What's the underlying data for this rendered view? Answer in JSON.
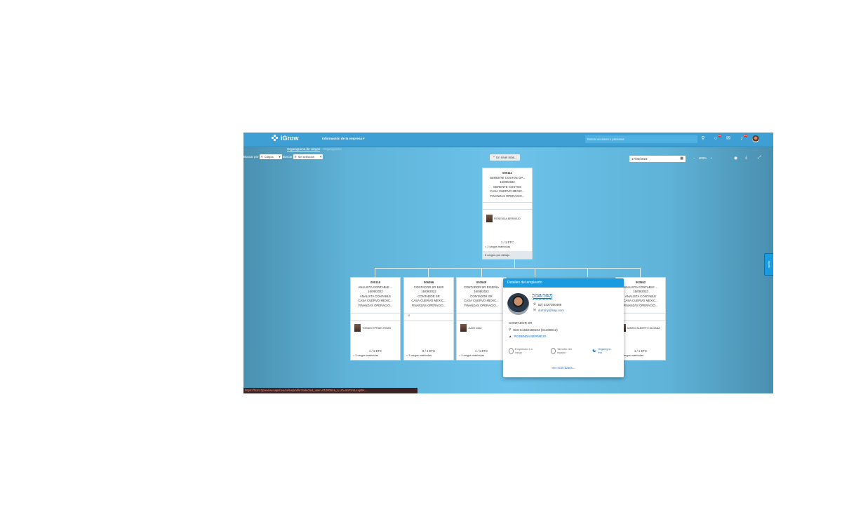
{
  "header": {
    "app_name": "iGrow",
    "menu_label": "Información de la empresa",
    "search_placeholder": "Buscar acciones o personas",
    "notif_badge_1": "99",
    "notif_badge_2": "99"
  },
  "subnav": {
    "active": "Organigrama de cargos",
    "next": "Organigrama"
  },
  "filters": {
    "label1": "Buscar por",
    "select1": "Cargos",
    "label2": "Buscar",
    "select2": "Sin selección"
  },
  "toolbar": {
    "up_level": "Un nivel más...",
    "date": "17/03/2023",
    "zoom": "100%"
  },
  "top_card": {
    "id": "000111",
    "title": "GERENTE COSTOS OP...",
    "date": "16/09/2022",
    "role": "GERENTE COSTOS",
    "company": "CASA CUERVO MEXIC...",
    "dept": "FINANZAS OPERACIO...",
    "person": "ROSENDA BERMEJO",
    "etc": "1 / 1 ETC",
    "sub": "= 3 cargos matriculas",
    "below": "6 cargos por debajo"
  },
  "cards": [
    {
      "id": "000115",
      "title": "ANALISTA CONTABLE ...",
      "date": "16/09/2022",
      "role": "ANALISTA CONTABLE",
      "company": "CASA CUERVO MEXIC...",
      "dept": "FINANZAS OPERACIO...",
      "person": "TOBIAS EPRAIN RIVAS",
      "etc": "1 / 1 ETC",
      "sub": "= 3 cargos matriculas"
    },
    {
      "id": "006396",
      "title": "CONTADOR SR 1600",
      "date": "16/09/2022",
      "role": "CONTADOR SR",
      "company": "CASA CUERVO MEXIC...",
      "dept": "FINANZAS OPERACIO...",
      "person": "",
      "etc": "0 / 1 ETC",
      "sub": "= 3 cargos matriculas"
    },
    {
      "id": "003549",
      "title": "CONTADOR SR ROJEÑA",
      "date": "16/09/2022",
      "role": "CONTADOR SR",
      "company": "CASA CUERVO MEXIC...",
      "dept": "FINANZAS OPERACIO...",
      "person": "JUAN DIAZ",
      "etc": "1 / 1 ETC",
      "sub": "= 3 cargos matriculas"
    },
    {
      "id": "003552",
      "title": "ANALISTA CONTABLE ...",
      "date": "16/09/2022",
      "role": "ANALISTA CONTABLE",
      "company": "CASA CUERVO MEXIC...",
      "dept": "FINANZAS OPERACIO...",
      "person": "MARIO ALBERTO ALDANA",
      "etc": "1 / 1 ETC",
      "sub": "= 3 cargos matriculas"
    }
  ],
  "popup": {
    "title": "Detalles del empleado",
    "name": "JUAN DIAZ",
    "phone": "52) 3327350466",
    "email": "dummy@sap.com",
    "role": "CONTADOR SR",
    "location": "833-C1632160104 (C1100012)",
    "manager": "ROSENDA BERMEJO",
    "action1": "Empleado 1 a cargo",
    "action2": "Tamaño del equipo",
    "action3": "Organigra ma",
    "more": "Ver más datos..."
  },
  "side_tab": "Ayuda",
  "status_url": "https://hcm12preview.sapsf.eu/xi/liveprofile?selected_user=0100054&_s.crb=9oFzmLexp0H..."
}
